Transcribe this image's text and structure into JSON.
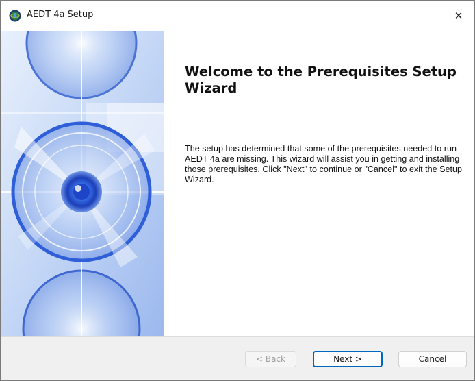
{
  "window": {
    "title": "AEDT 4a Setup",
    "close_glyph": "✕",
    "icons": {
      "app": "aedt-globe-icon",
      "close": "close-icon"
    }
  },
  "wizard": {
    "heading": "Welcome to the Prerequisites Setup Wizard",
    "body": "The setup has determined that some of the prerequisites needed to run AEDT 4a are missing. This wizard will assist you in getting and installing those prerequisites. Click \"Next\" to continue or \"Cancel\" to exit the Setup Wizard.",
    "banner_image": "cd-disc-artwork"
  },
  "buttons": {
    "back": {
      "label": "< Back",
      "enabled": false
    },
    "next": {
      "label": "Next >",
      "enabled": true,
      "default": true
    },
    "cancel": {
      "label": "Cancel",
      "enabled": true
    }
  },
  "colors": {
    "accent": "#0067c0",
    "footer_bg": "#f0f0f0",
    "banner_blue": "#2f5fd8"
  }
}
